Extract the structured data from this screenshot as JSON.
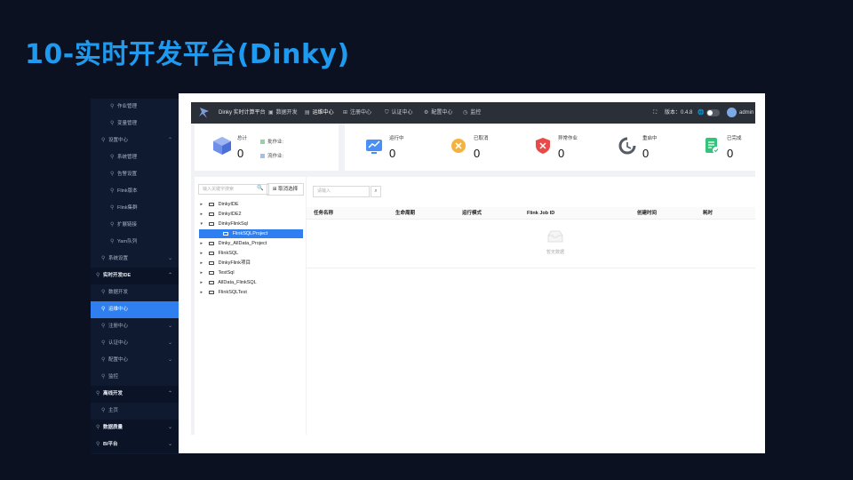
{
  "slide_title": "10-实时开发平台(Dinky)",
  "sidebar": {
    "items": [
      {
        "label": "作业管理",
        "level": 2
      },
      {
        "label": "变量管理",
        "level": 2
      },
      {
        "label": "设置中心",
        "level": 1,
        "expanded": true
      },
      {
        "label": "系统管理",
        "level": 2
      },
      {
        "label": "告警设置",
        "level": 2
      },
      {
        "label": "Flink版本",
        "level": 2
      },
      {
        "label": "Flink集群",
        "level": 2
      },
      {
        "label": "扩展链接",
        "level": 2
      },
      {
        "label": "Yarn队列",
        "level": 2
      },
      {
        "label": "系统设置",
        "level": 1,
        "expanded": false
      },
      {
        "label": "实时开发IDE",
        "level": 0,
        "expanded": true
      },
      {
        "label": "数据开发",
        "level": 1
      },
      {
        "label": "运维中心",
        "level": 1,
        "active": true
      },
      {
        "label": "注册中心",
        "level": 1,
        "expanded": false
      },
      {
        "label": "认证中心",
        "level": 1,
        "expanded": false
      },
      {
        "label": "配置中心",
        "level": 1,
        "expanded": false
      },
      {
        "label": "监控",
        "level": 1
      },
      {
        "label": "离线开发",
        "level": 0,
        "expanded": true
      },
      {
        "label": "主页",
        "level": 1
      },
      {
        "label": "数据质量",
        "level": 0,
        "expanded": false
      },
      {
        "label": "BI平台",
        "level": 0,
        "expanded": false
      }
    ]
  },
  "topbar": {
    "brand": "Dinky 实时计算平台",
    "nav": [
      {
        "label": "数据开发",
        "icon": "code-icon"
      },
      {
        "label": "运维中心",
        "icon": "monitor-icon",
        "active": true
      },
      {
        "label": "注册中心",
        "icon": "grid-icon"
      },
      {
        "label": "认证中心",
        "icon": "shield-icon"
      },
      {
        "label": "配置中心",
        "icon": "gear-icon"
      },
      {
        "label": "监控",
        "icon": "clock-icon"
      }
    ],
    "version": "版本：0.4.8",
    "user": "admin"
  },
  "stats": {
    "total_label": "总计",
    "total_value": "0",
    "batch_label": "批作业:",
    "stream_label": "流作业:",
    "items": [
      {
        "label": "运行中",
        "value": "0",
        "color": "#4a8ff5"
      },
      {
        "label": "已取消",
        "value": "0",
        "color": "#f5b23c"
      },
      {
        "label": "异常作业",
        "value": "0",
        "color": "#e84a4a"
      },
      {
        "label": "重启中",
        "value": "0",
        "color": "#555c66"
      },
      {
        "label": "已完成",
        "value": "0",
        "color": "#35c27a"
      }
    ]
  },
  "tree": {
    "search_placeholder": "输入关键字搜索",
    "deselect_label": "取消选择",
    "nodes": [
      {
        "label": "DinkyIDE",
        "expanded": false
      },
      {
        "label": "DinkyIDE2",
        "expanded": false
      },
      {
        "label": "DinkyFlinkSql",
        "expanded": true
      },
      {
        "label": "FlinkSQLProject",
        "child": true,
        "selected": true
      },
      {
        "label": "Dinky_AllData_Project",
        "expanded": false
      },
      {
        "label": "FlinkSQL",
        "expanded": false
      },
      {
        "label": "DinkyFlink项目",
        "expanded": false
      },
      {
        "label": "TestSql",
        "expanded": false
      },
      {
        "label": "AllData_FlinkSQL",
        "expanded": false
      },
      {
        "label": "FlinkSQLTest",
        "expanded": false
      }
    ]
  },
  "table": {
    "search_placeholder": "请输入",
    "columns": [
      "任务名称",
      "生命周期",
      "运行模式",
      "Flink Job ID",
      "创建时间",
      "耗时"
    ],
    "empty_text": "暂无数据"
  }
}
